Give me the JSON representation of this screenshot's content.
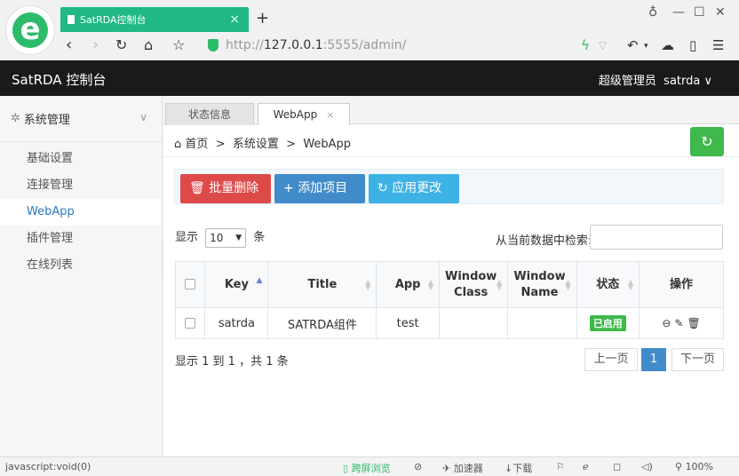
{
  "browser": {
    "tab_title": "SatRDA控制台",
    "tab_close": "×",
    "new_tab": "+",
    "url_prefix": "http://",
    "url_host": "127.0.0.1",
    "url_rest": ":5555/admin/",
    "status_left": "javascript:void(0)",
    "status_items": [
      "跨屏浏览",
      "加速器",
      "下载",
      "100%"
    ]
  },
  "app": {
    "title": "SatRDA 控制台",
    "user_role": "超级管理员",
    "user_name": "satrda"
  },
  "sidebar": {
    "group_label": "系统管理",
    "items": [
      {
        "label": "基础设置"
      },
      {
        "label": "连接管理"
      },
      {
        "label": "WebApp"
      },
      {
        "label": "插件管理"
      },
      {
        "label": "在线列表"
      }
    ],
    "active_index": 2
  },
  "page_tabs": [
    {
      "label": "状态信息"
    },
    {
      "label": "WebApp",
      "close": "×"
    }
  ],
  "breadcrumb": {
    "home": "首页",
    "sep": ">",
    "level1": "系统设置",
    "level2": "WebApp"
  },
  "toolbar": {
    "delete_label": "批量删除",
    "add_label": "添加项目",
    "apply_label": "应用更改"
  },
  "table_controls": {
    "show_prefix": "显示",
    "page_length": "10",
    "show_suffix": "条",
    "search_label": "从当前数据中检索:"
  },
  "table": {
    "columns": [
      "Key",
      "Title",
      "App",
      "Window Class",
      "Window Name",
      "状态",
      "操作"
    ],
    "rows": [
      {
        "key": "satrda",
        "title": "SATRDA组件",
        "app": "test",
        "window_class": "",
        "window_name": "",
        "status": "已启用"
      }
    ]
  },
  "pagination": {
    "info": "显示 1 到 1 ，共 1 条",
    "prev": "上一页",
    "current": "1",
    "next": "下一页"
  },
  "colors": {
    "brand_green": "#1fb886",
    "header_bg": "#1a1a1a",
    "danger": "#dd4b49",
    "primary": "#428bca",
    "info": "#3fb2e5",
    "success": "#3fb84c"
  }
}
